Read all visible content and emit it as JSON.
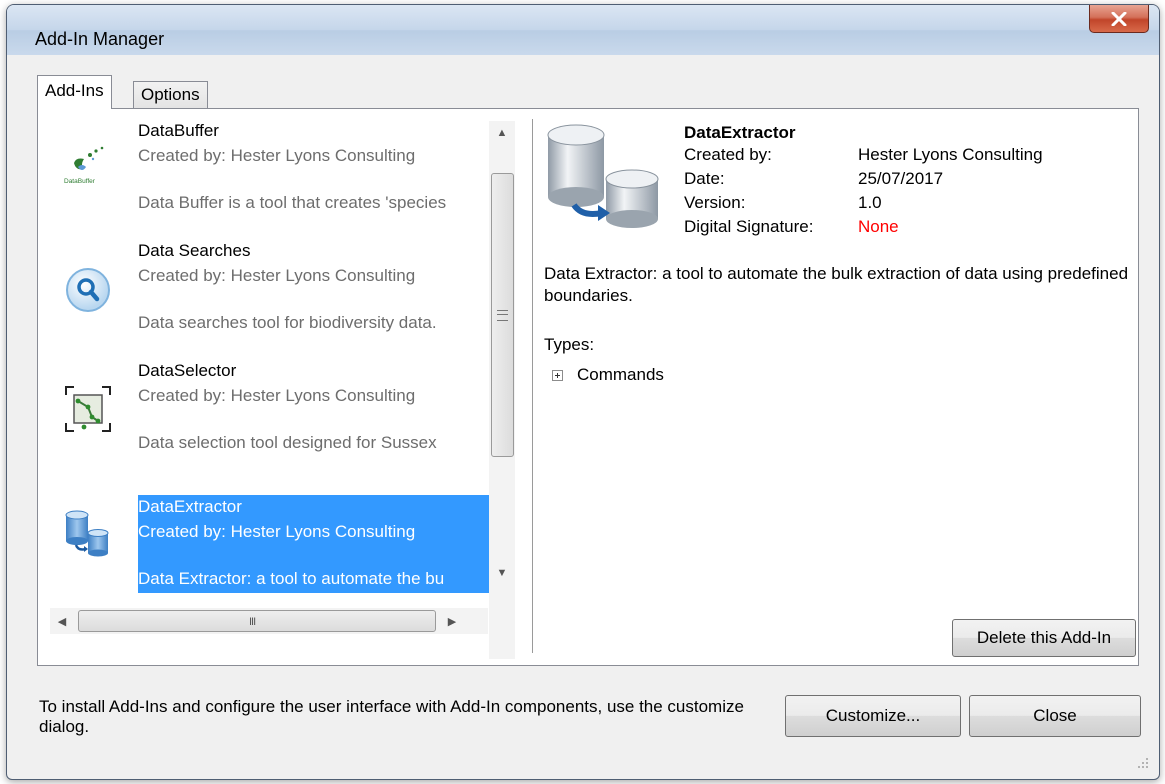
{
  "window": {
    "title": "Add-In Manager"
  },
  "tabs": [
    {
      "label": "Add-Ins",
      "active": true
    },
    {
      "label": "Options",
      "active": false
    }
  ],
  "addins": [
    {
      "name": "DataBuffer",
      "author": "Created by: Hester Lyons Consulting",
      "description": "Data Buffer is a tool that creates 'species",
      "icon": "databuffer-icon",
      "icon_caption": "DataBuffer"
    },
    {
      "name": "Data Searches",
      "author": "Created by: Hester Lyons Consulting",
      "description": "Data searches tool for biodiversity data.",
      "icon": "magnifier-icon"
    },
    {
      "name": "DataSelector",
      "author": "Created by: Hester Lyons Consulting",
      "description": "Data selection tool designed for Sussex",
      "icon": "dataselector-icon"
    },
    {
      "name": "DataExtractor",
      "author": "Created by: Hester Lyons Consulting",
      "description": "Data Extractor: a tool to automate the bu",
      "icon": "database-transfer-icon",
      "selected": true
    }
  ],
  "details": {
    "name": "DataExtractor",
    "created_by_label": "Created by:",
    "created_by": "Hester Lyons Consulting",
    "date_label": "Date:",
    "date": "25/07/2017",
    "version_label": "Version:",
    "version": "1.0",
    "signature_label": "Digital Signature:",
    "signature": "None",
    "description": "Data Extractor: a tool to automate the bulk extraction of data using predefined boundaries.",
    "types_label": "Types:",
    "tree_item": "Commands",
    "delete_label": "Delete this Add-In"
  },
  "footer": {
    "text": "To install Add-Ins and configure the user interface with Add-In components, use the customize dialog.",
    "customize_label": "Customize...",
    "close_label": "Close"
  },
  "colors": {
    "selection": "#3399ff",
    "signature_none": "#ff0000",
    "close_button": "#c1452a"
  }
}
